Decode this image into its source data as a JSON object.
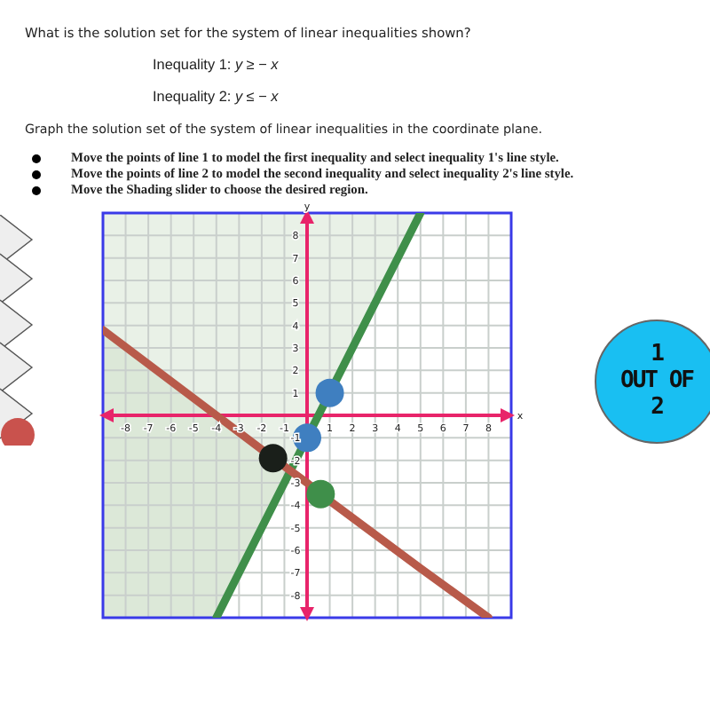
{
  "question": "What is the solution set for the system of linear inequalities shown?",
  "inequalities": [
    {
      "text": "Inequality 1: *y*  ≥ − *x*"
    },
    {
      "text": "Inequality 2: *y*  ≤ − *x*"
    }
  ],
  "prompt": "Graph the solution set of the system of linear inequalities in the coordinate plane.",
  "instructions": [
    "Move the points of line 1 to model the first inequality and select inequality 1's line style.",
    "Move the points of line 2 to model the second inequality and select inequality 2's line style.",
    "Move the Shading slider to choose the desired region."
  ],
  "graph": {
    "chart_data": {
      "type": "line",
      "xlabel": "x",
      "ylabel": "y",
      "x": [
        -9,
        -4,
        -1.5,
        0,
        0.6,
        1,
        5,
        8
      ],
      "series": [
        {
          "color": "#3f8f4a",
          "values": [
            null,
            -9,
            -4,
            -1,
            0.2,
            1,
            9,
            null
          ]
        },
        {
          "color": "#b85a4a",
          "values": [
            3.8,
            0,
            -1.9,
            -3,
            -3.5,
            -3.8,
            -6.8,
            -9
          ]
        }
      ],
      "grid": true,
      "xlim": [
        -9,
        9
      ],
      "ylim": [
        -9,
        9
      ],
      "xticks": [
        -8,
        -7,
        -6,
        -5,
        -4,
        -3,
        -2,
        -1,
        1,
        2,
        3,
        4,
        5,
        6,
        7,
        8
      ],
      "yticks": [
        -8,
        -7,
        -6,
        -5,
        -4,
        -3,
        -2,
        -1,
        1,
        2,
        3,
        4,
        5,
        6,
        7,
        8
      ]
    },
    "handles": [
      {
        "line": "1",
        "color": "#3f7fc0"
      },
      {
        "line": "1",
        "color": "#3f7fc0"
      },
      {
        "line": "2",
        "color": "#1a1f1a"
      },
      {
        "line": "2",
        "color": "#3f8f4a"
      }
    ]
  },
  "progress": {
    "current": "1",
    "middle": "OUT OF",
    "total": "2"
  }
}
